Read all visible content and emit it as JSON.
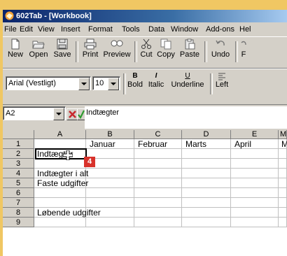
{
  "window": {
    "title": "602Tab - [Workbook]"
  },
  "menu": [
    "File",
    "Edit",
    "View",
    "Insert",
    "Format",
    "Tools",
    "Data",
    "Window",
    "Add-ons",
    "Hel"
  ],
  "toolbar": {
    "buttons": [
      {
        "label": "New",
        "icon": "new-document-icon"
      },
      {
        "label": "Open",
        "icon": "open-folder-icon"
      },
      {
        "label": "Save",
        "icon": "save-disk-icon"
      },
      {
        "label": "Print",
        "icon": "printer-icon"
      },
      {
        "label": "Preview",
        "icon": "print-preview-icon"
      },
      {
        "label": "Cut",
        "icon": "scissors-icon"
      },
      {
        "label": "Copy",
        "icon": "copy-icon"
      },
      {
        "label": "Paste",
        "icon": "paste-icon"
      },
      {
        "label": "Undo",
        "icon": "undo-icon"
      },
      {
        "label": "F",
        "icon": "redo-icon"
      }
    ]
  },
  "format_toolbar": {
    "font": "Arial (Vestligt)",
    "size": "10",
    "bold_label": "Bold",
    "bold_glyph": "B",
    "italic_label": "Italic",
    "italic_glyph": "I",
    "underline_label": "Underline",
    "underline_glyph": "U",
    "left_label": "Left"
  },
  "formula_bar": {
    "cell_ref": "A2",
    "content": "Indtægter"
  },
  "sheet": {
    "columns": [
      "A",
      "B",
      "C",
      "D",
      "E",
      "M"
    ],
    "rows": [
      "1",
      "2",
      "3",
      "4",
      "5",
      "6",
      "7",
      "8",
      "9"
    ],
    "cells": {
      "B1": "Januar",
      "C1": "Februar",
      "D1": "Marts",
      "E1": "April",
      "F1": "M",
      "A2": "Indtægter",
      "A4": "Indtægter i alt",
      "A5": "Faste udgifter",
      "A8": "Løbende udgifter"
    },
    "active_cell": "A2"
  },
  "step_badge": "4",
  "colors": {
    "badge": "#d8322b",
    "title_bar": "#0a246a",
    "accept": "#2e9a2e",
    "cancel": "#c8282d"
  }
}
